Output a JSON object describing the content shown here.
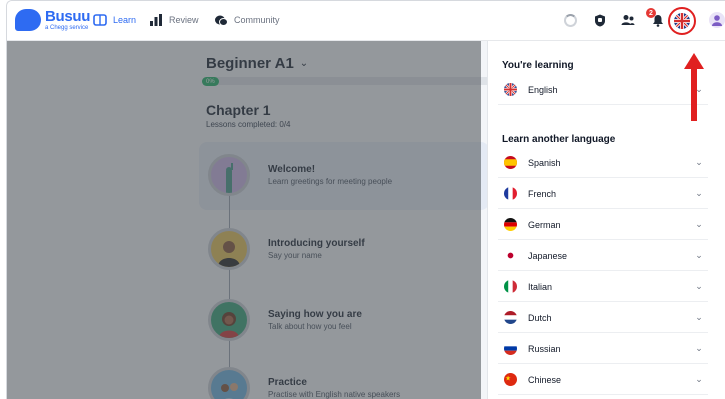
{
  "brand": {
    "name": "Busuu",
    "sub": "a Chegg service"
  },
  "nav": {
    "learn": "Learn",
    "review": "Review",
    "community": "Community",
    "notification_count": "2"
  },
  "course": {
    "level": "Beginner A1",
    "progress_label": "0%",
    "progress_value": 0,
    "chapter": "Chapter 1",
    "lessons_completed": "Lessons completed: 0/4"
  },
  "lessons": [
    {
      "title": "Welcome!",
      "subtitle": "Learn greetings for meeting people"
    },
    {
      "title": "Introducing yourself",
      "subtitle": "Say your name"
    },
    {
      "title": "Saying how you are",
      "subtitle": "Talk about how you feel"
    },
    {
      "title": "Practice",
      "subtitle": "Practise with English native speakers"
    }
  ],
  "panel": {
    "learning_heading": "You're learning",
    "current": {
      "name": "English",
      "flag": "uk-flag"
    },
    "another_heading": "Learn another language",
    "languages": [
      {
        "name": "Spanish",
        "flag": "spain-flag"
      },
      {
        "name": "French",
        "flag": "france-flag"
      },
      {
        "name": "German",
        "flag": "germany-flag"
      },
      {
        "name": "Japanese",
        "flag": "japan-flag"
      },
      {
        "name": "Italian",
        "flag": "italy-flag"
      },
      {
        "name": "Dutch",
        "flag": "netherlands-flag"
      },
      {
        "name": "Russian",
        "flag": "russia-flag"
      },
      {
        "name": "Chinese",
        "flag": "china-flag"
      }
    ]
  },
  "colors": {
    "brand": "#2e6bf2",
    "highlight": "#e02020",
    "progress": "#27b36a"
  }
}
